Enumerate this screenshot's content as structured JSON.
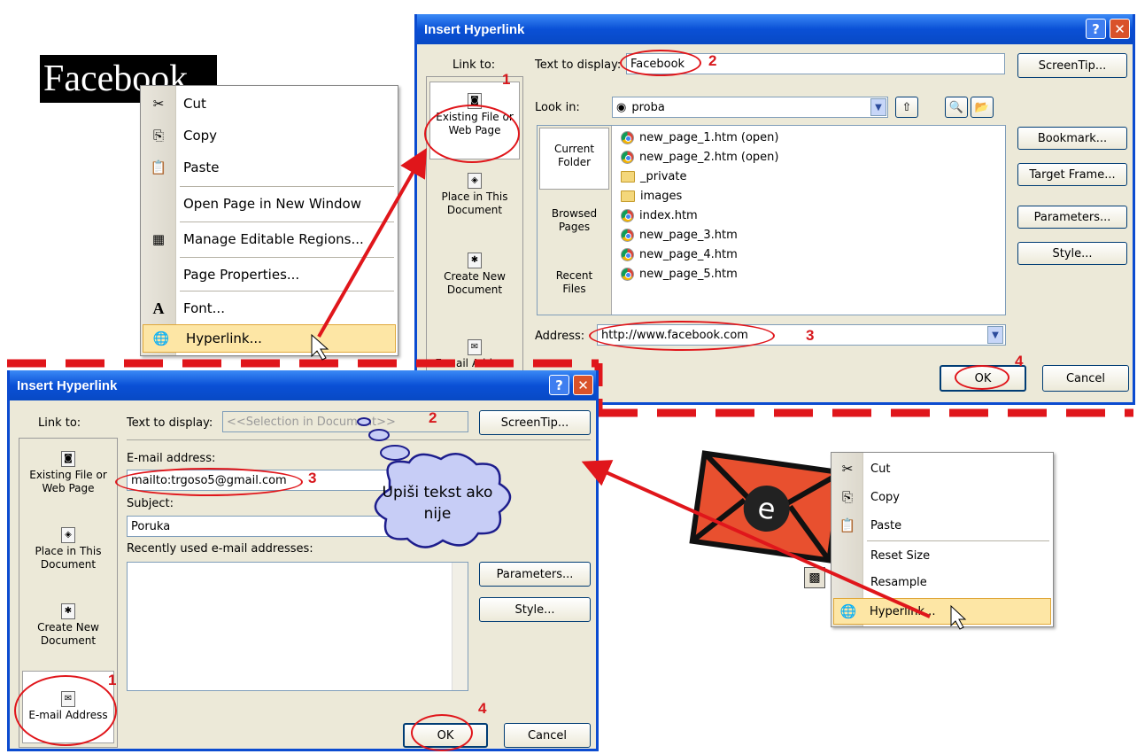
{
  "facebook_text": "Facebook",
  "menu1": {
    "items": [
      {
        "label": "Cut",
        "icon": "scissors-icon",
        "glyph": "✂"
      },
      {
        "label": "Copy",
        "icon": "copy-icon",
        "glyph": "⎘"
      },
      {
        "label": "Paste",
        "icon": "paste-icon",
        "glyph": "📋"
      },
      {
        "label": "Open Page in New Window",
        "icon": "",
        "glyph": ""
      },
      {
        "label": "Manage Editable Regions...",
        "icon": "regions-icon",
        "glyph": "▦"
      },
      {
        "label": "Page Properties...",
        "icon": "",
        "glyph": ""
      },
      {
        "label": "Font...",
        "icon": "font-icon",
        "glyph": "A"
      },
      {
        "label": "Hyperlink...",
        "icon": "hyperlink-icon",
        "glyph": "🌐"
      }
    ]
  },
  "dialog1": {
    "title": "Insert Hyperlink",
    "help": "?",
    "close": "✕",
    "link_to_label": "Link to:",
    "link_to": [
      "Existing File or Web Page",
      "Place in This Document",
      "Create New Document",
      "E-mail Address"
    ],
    "text_to_display_label": "Text to display:",
    "text_to_display_value": "Facebook",
    "screentip": "ScreenTip...",
    "look_in_label": "Look in:",
    "look_in_value": "proba",
    "side_tabs": [
      "Current Folder",
      "Browsed Pages",
      "Recent Files"
    ],
    "files": [
      {
        "name": "new_page_1.htm (open)",
        "type": "chrome"
      },
      {
        "name": "new_page_2.htm (open)",
        "type": "chrome"
      },
      {
        "name": "_private",
        "type": "folder"
      },
      {
        "name": "images",
        "type": "folder"
      },
      {
        "name": "index.htm",
        "type": "chrome"
      },
      {
        "name": "new_page_3.htm",
        "type": "chrome"
      },
      {
        "name": "new_page_4.htm",
        "type": "chrome"
      },
      {
        "name": "new_page_5.htm",
        "type": "chrome"
      }
    ],
    "right_buttons": [
      "Bookmark...",
      "Target Frame...",
      "Parameters...",
      "Style..."
    ],
    "address_label": "Address:",
    "address_value": "http://www.facebook.com",
    "ok": "OK",
    "cancel": "Cancel"
  },
  "dialog2": {
    "title": "Insert Hyperlink",
    "help": "?",
    "close": "✕",
    "link_to_label": "Link to:",
    "link_to": [
      "Existing File or Web Page",
      "Place in This Document",
      "Create New Document",
      "E-mail Address"
    ],
    "text_to_display_label": "Text to display:",
    "text_to_display_value": "<<Selection in Document>>",
    "screentip": "ScreenTip...",
    "email_label": "E-mail address:",
    "email_value": "mailto:trgoso5@gmail.com",
    "subject_label": "Subject:",
    "subject_value": "Poruka",
    "recent_label": "Recently used e-mail addresses:",
    "parameters": "Parameters...",
    "style": "Style...",
    "ok": "OK",
    "cancel": "Cancel"
  },
  "cloud_text": "Upiši tekst ako nije",
  "menu2": {
    "items": [
      {
        "label": "Cut",
        "icon": "scissors-icon",
        "glyph": "✂"
      },
      {
        "label": "Copy",
        "icon": "copy-icon",
        "glyph": "⎘"
      },
      {
        "label": "Paste",
        "icon": "paste-icon",
        "glyph": "📋"
      },
      {
        "label": "Reset Size",
        "icon": "",
        "glyph": ""
      },
      {
        "label": "Resample",
        "icon": "",
        "glyph": ""
      },
      {
        "label": "Hyperlink...",
        "icon": "hyperlink-icon",
        "glyph": "🌐"
      }
    ]
  },
  "annotations": {
    "n1": "1",
    "n2": "2",
    "n3": "3",
    "n4": "4"
  },
  "colors": {
    "annotation_red": "#e0161b",
    "envelope": "#e8502f",
    "titlebar": "#0a50d6"
  }
}
